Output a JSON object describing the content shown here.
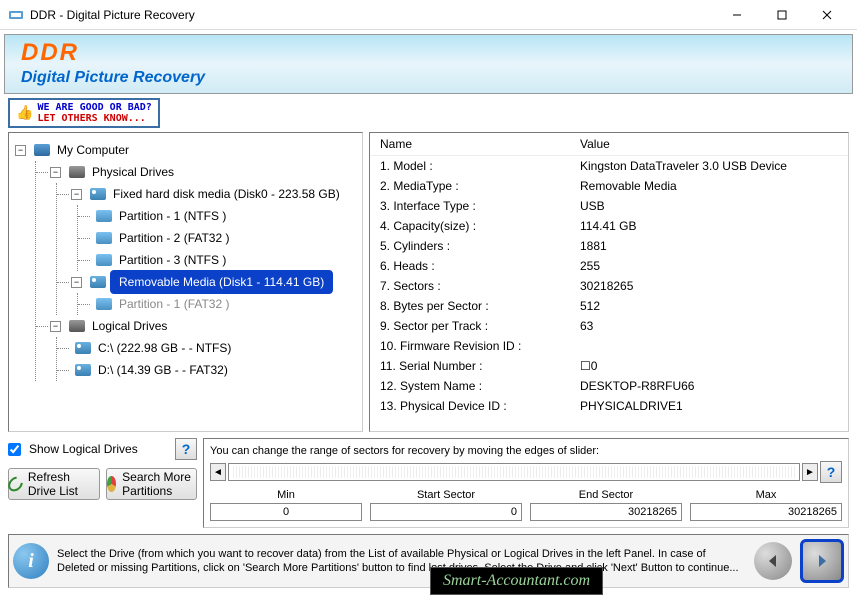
{
  "titlebar": {
    "title": "DDR - Digital Picture Recovery"
  },
  "header": {
    "logo": "DDR",
    "subtitle": "Digital Picture Recovery"
  },
  "feedback": {
    "line1": "WE ARE GOOD OR BAD?",
    "line2": "LET OTHERS KNOW..."
  },
  "tree": {
    "root": "My Computer",
    "physical": "Physical Drives",
    "disk0": "Fixed hard disk media (Disk0 - 223.58 GB)",
    "p0_1": "Partition - 1 (NTFS )",
    "p0_2": "Partition - 2 (FAT32 )",
    "p0_3": "Partition - 3 (NTFS )",
    "disk1": "Removable Media (Disk1 - 114.41 GB)",
    "p1_1": "Partition - 1 (FAT32 )",
    "logical": "Logical Drives",
    "c": "C:\\ (222.98 GB -  - NTFS)",
    "d": "D:\\ (14.39 GB -  - FAT32)"
  },
  "details": {
    "header_name": "Name",
    "header_value": "Value",
    "rows": [
      {
        "name": "1. Model :",
        "value": "Kingston DataTraveler 3.0 USB Device"
      },
      {
        "name": "2. MediaType :",
        "value": "Removable Media"
      },
      {
        "name": "3. Interface Type :",
        "value": "USB"
      },
      {
        "name": "4. Capacity(size) :",
        "value": "114.41 GB"
      },
      {
        "name": "5. Cylinders :",
        "value": "1881"
      },
      {
        "name": "6. Heads :",
        "value": "255"
      },
      {
        "name": "7. Sectors :",
        "value": "30218265"
      },
      {
        "name": "8. Bytes per Sector :",
        "value": "512"
      },
      {
        "name": "9. Sector per Track :",
        "value": "63"
      },
      {
        "name": "10. Firmware Revision ID :",
        "value": ""
      },
      {
        "name": "11. Serial Number :",
        "value": "☐0"
      },
      {
        "name": "12. System Name :",
        "value": "DESKTOP-R8RFU66"
      },
      {
        "name": "13. Physical Device ID :",
        "value": "PHYSICALDRIVE1"
      }
    ]
  },
  "controls": {
    "show_logical": "Show Logical Drives",
    "refresh": "Refresh Drive List",
    "search_more": "Search More Partitions",
    "sector_hint": "You can change the range of sectors for recovery by moving the edges of slider:",
    "min_label": "Min",
    "start_label": "Start Sector",
    "end_label": "End Sector",
    "max_label": "Max",
    "min_value": "0",
    "start_value": "0",
    "end_value": "30218265",
    "max_value": "30218265"
  },
  "footer": {
    "text": "Select the Drive (from which you want to recover data) from the List of available Physical or Logical Drives in the left Panel. In case of Deleted or missing Partitions, click on 'Search More Partitions' button to find lost drives. Select the Drive and click 'Next' Button to continue..."
  },
  "watermark": "Smart-Accountant.com"
}
